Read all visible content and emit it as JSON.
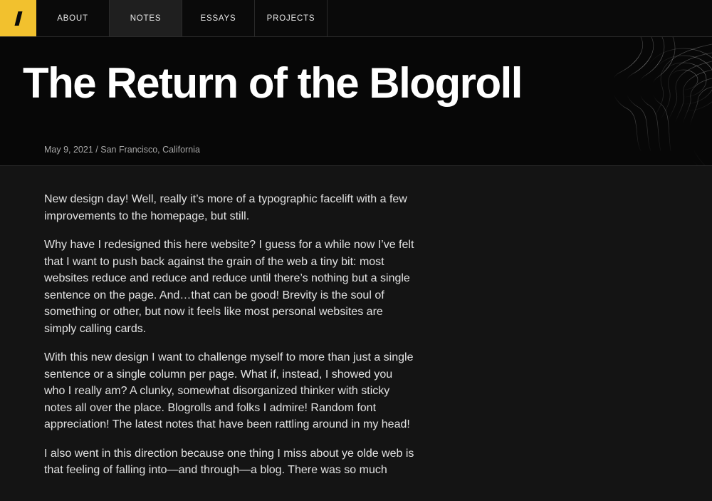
{
  "nav": {
    "logo_mark": "/",
    "items": [
      {
        "label": "ABOUT"
      },
      {
        "label": "NOTES"
      },
      {
        "label": "ESSAYS"
      },
      {
        "label": "PROJECTS"
      }
    ]
  },
  "hero": {
    "title": "The Return of the Blogroll",
    "date": "May 9, 2021",
    "separator": "/",
    "location": "San Francisco, California"
  },
  "article": {
    "paragraphs": [
      "New design day! Well, really it’s more of a typographic facelift with a few improvements to the homepage, but still.",
      "Why have I redesigned this here website? I guess for a while now I’ve felt that I want to push back against the grain of the web a tiny bit: most websites reduce and reduce and reduce until there’s nothing but a single sentence on the page. And…that can be good! Brevity is the soul of something or other, but now it feels like most personal websites are simply calling cards.",
      "With this new design I want to challenge myself to more than just a single sentence or a single column per page. What if, instead, I showed you who I really am? A clunky, somewhat disorganized thinker with sticky notes all over the place. Blogrolls and folks I admire! Random font appreciation! The latest notes that have been rattling around in my head!",
      "I also went in this direction because one thing I miss about ye olde web is that feeling of falling into—and through—a blog. There was so much"
    ]
  },
  "colors": {
    "accent": "#f2c12e",
    "background": "#141414",
    "hero_background": "#070707",
    "text": "#e2e2e2",
    "meta_text": "#a8a8a8"
  }
}
